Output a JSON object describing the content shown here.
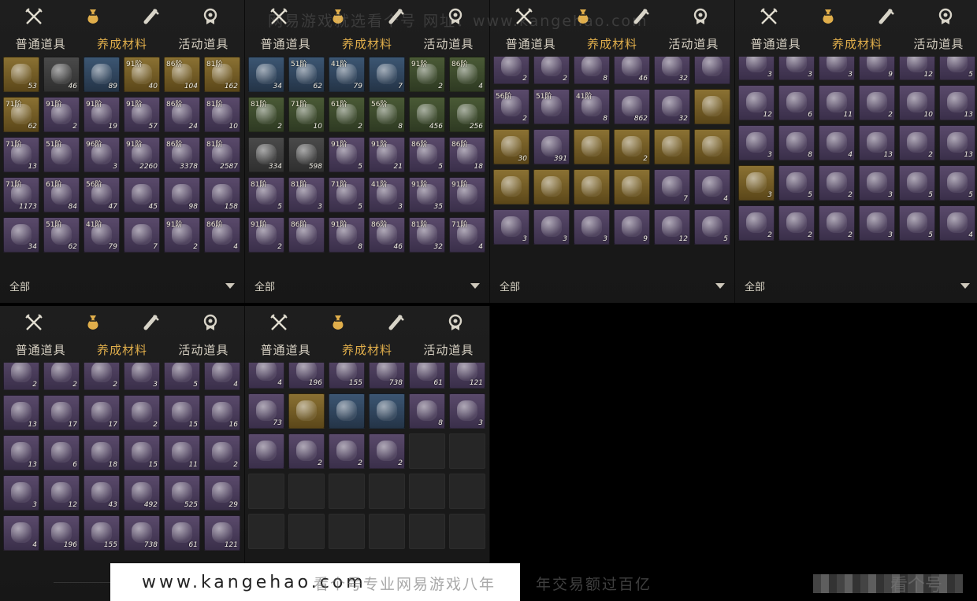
{
  "tabs": [
    "普通道具",
    "养成材料",
    "活动道具"
  ],
  "active_tab_index": 1,
  "filter_label": "全部",
  "watermark_top": "网易游戏就选看个号  网址：www.kangehao.com",
  "footer": {
    "url": "www.kangehao.com",
    "slogan": "看个号专业网易游戏八年",
    "slogan2": "年交易额过百亿",
    "logo": "看个号"
  },
  "colors": {
    "accent": "#e0ae4b",
    "panel_bg": "#1b1b1b"
  },
  "icons": [
    "swords-icon",
    "pouch-icon",
    "scroll-icon",
    "badge-icon"
  ],
  "panels": [
    {
      "id": "p1",
      "items": [
        {
          "r": "gold",
          "g": "",
          "c": "53"
        },
        {
          "r": "gray",
          "g": "",
          "c": "46"
        },
        {
          "r": "blue",
          "g": "",
          "c": "89"
        },
        {
          "r": "gold",
          "g": "91阶",
          "c": "40"
        },
        {
          "r": "gold",
          "g": "86阶",
          "c": "104"
        },
        {
          "r": "gold",
          "g": "81阶",
          "c": "162"
        },
        {
          "r": "gold",
          "g": "71阶",
          "c": "62"
        },
        {
          "r": "purple",
          "g": "91阶",
          "c": "2"
        },
        {
          "r": "purple",
          "g": "91阶",
          "c": "19"
        },
        {
          "r": "purple",
          "g": "91阶",
          "c": "57"
        },
        {
          "r": "purple",
          "g": "86阶",
          "c": "24"
        },
        {
          "r": "purple",
          "g": "81阶",
          "c": "10"
        },
        {
          "r": "purple",
          "g": "71阶",
          "c": "13"
        },
        {
          "r": "purple",
          "g": "51阶",
          "c": ""
        },
        {
          "r": "purple",
          "g": "96阶",
          "c": "3"
        },
        {
          "r": "purple",
          "g": "91阶",
          "c": "2260"
        },
        {
          "r": "purple",
          "g": "86阶",
          "c": "3378"
        },
        {
          "r": "purple",
          "g": "81阶",
          "c": "2587"
        },
        {
          "r": "purple",
          "g": "71阶",
          "c": "1173"
        },
        {
          "r": "purple",
          "g": "61阶",
          "c": "84"
        },
        {
          "r": "purple",
          "g": "56阶",
          "c": "47"
        },
        {
          "r": "purple",
          "g": "",
          "c": "45"
        },
        {
          "r": "purple",
          "g": "",
          "c": "98"
        },
        {
          "r": "purple",
          "g": "",
          "c": "158"
        },
        {
          "r": "purple",
          "g": "",
          "c": "34"
        },
        {
          "r": "purple",
          "g": "51阶",
          "c": "62"
        },
        {
          "r": "purple",
          "g": "41阶",
          "c": "79"
        },
        {
          "r": "purple",
          "g": "",
          "c": "7"
        },
        {
          "r": "purple",
          "g": "91阶",
          "c": "2"
        },
        {
          "r": "purple",
          "g": "86阶",
          "c": "4"
        }
      ]
    },
    {
      "id": "p2",
      "items": [
        {
          "r": "blue",
          "g": "",
          "c": "34"
        },
        {
          "r": "blue",
          "g": "51阶",
          "c": "62"
        },
        {
          "r": "blue",
          "g": "41阶",
          "c": "79"
        },
        {
          "r": "blue",
          "g": "",
          "c": "7"
        },
        {
          "r": "green",
          "g": "91阶",
          "c": "2"
        },
        {
          "r": "green",
          "g": "86阶",
          "c": "4"
        },
        {
          "r": "green",
          "g": "81阶",
          "c": "2"
        },
        {
          "r": "green",
          "g": "71阶",
          "c": "10"
        },
        {
          "r": "green",
          "g": "61阶",
          "c": "2"
        },
        {
          "r": "green",
          "g": "56阶",
          "c": "8"
        },
        {
          "r": "green",
          "g": "",
          "c": "456"
        },
        {
          "r": "green",
          "g": "",
          "c": "256"
        },
        {
          "r": "gray",
          "g": "",
          "c": "334"
        },
        {
          "r": "gray",
          "g": "",
          "c": "598"
        },
        {
          "r": "purple",
          "g": "91阶",
          "c": "5"
        },
        {
          "r": "purple",
          "g": "91阶",
          "c": "21"
        },
        {
          "r": "purple",
          "g": "86阶",
          "c": "5"
        },
        {
          "r": "purple",
          "g": "86阶",
          "c": "18"
        },
        {
          "r": "purple",
          "g": "81阶",
          "c": "5"
        },
        {
          "r": "purple",
          "g": "81阶",
          "c": "3"
        },
        {
          "r": "purple",
          "g": "71阶",
          "c": "5"
        },
        {
          "r": "purple",
          "g": "41阶",
          "c": "3"
        },
        {
          "r": "purple",
          "g": "91阶",
          "c": "35"
        },
        {
          "r": "purple",
          "g": "91阶",
          "c": ""
        },
        {
          "r": "purple",
          "g": "91阶",
          "c": "2"
        },
        {
          "r": "purple",
          "g": "86阶",
          "c": ""
        },
        {
          "r": "purple",
          "g": "91阶",
          "c": "8"
        },
        {
          "r": "purple",
          "g": "86阶",
          "c": "46"
        },
        {
          "r": "purple",
          "g": "81阶",
          "c": "32"
        },
        {
          "r": "purple",
          "g": "71阶",
          "c": "4"
        }
      ]
    },
    {
      "id": "p3",
      "items": [
        {
          "r": "purple",
          "g": "",
          "c": "2"
        },
        {
          "r": "purple",
          "g": "",
          "c": "2"
        },
        {
          "r": "purple",
          "g": "",
          "c": "8"
        },
        {
          "r": "purple",
          "g": "",
          "c": "46"
        },
        {
          "r": "purple",
          "g": "",
          "c": "32"
        },
        {
          "r": "purple",
          "g": "",
          "c": ""
        },
        {
          "r": "purple",
          "g": "56阶",
          "c": "2"
        },
        {
          "r": "purple",
          "g": "51阶",
          "c": ""
        },
        {
          "r": "purple",
          "g": "41阶",
          "c": "8"
        },
        {
          "r": "purple",
          "g": "",
          "c": "862"
        },
        {
          "r": "purple",
          "g": "",
          "c": "32"
        },
        {
          "r": "gold",
          "g": "",
          "c": ""
        },
        {
          "r": "gold",
          "g": "",
          "c": "30"
        },
        {
          "r": "purple",
          "g": "",
          "c": "391"
        },
        {
          "r": "gold",
          "g": "",
          "c": ""
        },
        {
          "r": "gold",
          "g": "",
          "c": "2"
        },
        {
          "r": "gold",
          "g": "",
          "c": ""
        },
        {
          "r": "gold",
          "g": "",
          "c": ""
        },
        {
          "r": "gold",
          "g": "",
          "c": ""
        },
        {
          "r": "gold",
          "g": "",
          "c": ""
        },
        {
          "r": "gold",
          "g": "",
          "c": ""
        },
        {
          "r": "gold",
          "g": "",
          "c": ""
        },
        {
          "r": "purple",
          "g": "",
          "c": "7"
        },
        {
          "r": "purple",
          "g": "",
          "c": "4"
        },
        {
          "r": "purple",
          "g": "",
          "c": "3"
        },
        {
          "r": "purple",
          "g": "",
          "c": "3"
        },
        {
          "r": "purple",
          "g": "",
          "c": "3"
        },
        {
          "r": "purple",
          "g": "",
          "c": "9"
        },
        {
          "r": "purple",
          "g": "",
          "c": "12"
        },
        {
          "r": "purple",
          "g": "",
          "c": "5"
        }
      ]
    },
    {
      "id": "p4",
      "items": [
        {
          "r": "purple",
          "g": "",
          "c": "3"
        },
        {
          "r": "purple",
          "g": "",
          "c": "3"
        },
        {
          "r": "purple",
          "g": "",
          "c": "3"
        },
        {
          "r": "purple",
          "g": "",
          "c": "9"
        },
        {
          "r": "purple",
          "g": "",
          "c": "12"
        },
        {
          "r": "purple",
          "g": "",
          "c": "5"
        },
        {
          "r": "purple",
          "g": "",
          "c": "12"
        },
        {
          "r": "purple",
          "g": "",
          "c": "6"
        },
        {
          "r": "purple",
          "g": "",
          "c": "11"
        },
        {
          "r": "purple",
          "g": "",
          "c": "2"
        },
        {
          "r": "purple",
          "g": "",
          "c": "10"
        },
        {
          "r": "purple",
          "g": "",
          "c": "13"
        },
        {
          "r": "purple",
          "g": "",
          "c": "3"
        },
        {
          "r": "purple",
          "g": "",
          "c": "8"
        },
        {
          "r": "purple",
          "g": "",
          "c": "4"
        },
        {
          "r": "purple",
          "g": "",
          "c": "13"
        },
        {
          "r": "purple",
          "g": "",
          "c": "2"
        },
        {
          "r": "purple",
          "g": "",
          "c": "13"
        },
        {
          "r": "gold",
          "g": "",
          "c": "3"
        },
        {
          "r": "purple",
          "g": "",
          "c": "5"
        },
        {
          "r": "purple",
          "g": "",
          "c": "2"
        },
        {
          "r": "purple",
          "g": "",
          "c": "3"
        },
        {
          "r": "purple",
          "g": "",
          "c": "5"
        },
        {
          "r": "purple",
          "g": "",
          "c": "5"
        },
        {
          "r": "purple",
          "g": "",
          "c": "2"
        },
        {
          "r": "purple",
          "g": "",
          "c": "2"
        },
        {
          "r": "purple",
          "g": "",
          "c": "2"
        },
        {
          "r": "purple",
          "g": "",
          "c": "3"
        },
        {
          "r": "purple",
          "g": "",
          "c": "5"
        },
        {
          "r": "purple",
          "g": "",
          "c": "4"
        }
      ]
    },
    {
      "id": "p5",
      "items": [
        {
          "r": "purple",
          "g": "",
          "c": "2"
        },
        {
          "r": "purple",
          "g": "",
          "c": "2"
        },
        {
          "r": "purple",
          "g": "",
          "c": "2"
        },
        {
          "r": "purple",
          "g": "",
          "c": "3"
        },
        {
          "r": "purple",
          "g": "",
          "c": "5"
        },
        {
          "r": "purple",
          "g": "",
          "c": "4"
        },
        {
          "r": "purple",
          "g": "",
          "c": "13"
        },
        {
          "r": "purple",
          "g": "",
          "c": "17"
        },
        {
          "r": "purple",
          "g": "",
          "c": "17"
        },
        {
          "r": "purple",
          "g": "",
          "c": "2"
        },
        {
          "r": "purple",
          "g": "",
          "c": "15"
        },
        {
          "r": "purple",
          "g": "",
          "c": "16"
        },
        {
          "r": "purple",
          "g": "",
          "c": "13"
        },
        {
          "r": "purple",
          "g": "",
          "c": "6"
        },
        {
          "r": "purple",
          "g": "",
          "c": "18"
        },
        {
          "r": "purple",
          "g": "",
          "c": "15"
        },
        {
          "r": "purple",
          "g": "",
          "c": "11"
        },
        {
          "r": "purple",
          "g": "",
          "c": "2"
        },
        {
          "r": "purple",
          "g": "",
          "c": "3"
        },
        {
          "r": "purple",
          "g": "",
          "c": "12"
        },
        {
          "r": "purple",
          "g": "",
          "c": "43"
        },
        {
          "r": "purple",
          "g": "",
          "c": "492"
        },
        {
          "r": "purple",
          "g": "",
          "c": "525"
        },
        {
          "r": "purple",
          "g": "",
          "c": "29"
        },
        {
          "r": "purple",
          "g": "",
          "c": "4"
        },
        {
          "r": "purple",
          "g": "",
          "c": "196"
        },
        {
          "r": "purple",
          "g": "",
          "c": "155"
        },
        {
          "r": "purple",
          "g": "",
          "c": "738"
        },
        {
          "r": "purple",
          "g": "",
          "c": "61"
        },
        {
          "r": "purple",
          "g": "",
          "c": "121"
        }
      ]
    },
    {
      "id": "p6",
      "items": [
        {
          "r": "purple",
          "g": "",
          "c": "4"
        },
        {
          "r": "purple",
          "g": "",
          "c": "196"
        },
        {
          "r": "purple",
          "g": "",
          "c": "155"
        },
        {
          "r": "purple",
          "g": "",
          "c": "738"
        },
        {
          "r": "purple",
          "g": "",
          "c": "61"
        },
        {
          "r": "purple",
          "g": "",
          "c": "121"
        },
        {
          "r": "purple",
          "g": "",
          "c": "73"
        },
        {
          "r": "gold",
          "g": "",
          "c": ""
        },
        {
          "r": "blue",
          "g": "",
          "c": ""
        },
        {
          "r": "blue",
          "g": "",
          "c": ""
        },
        {
          "r": "purple",
          "g": "",
          "c": "8"
        },
        {
          "r": "purple",
          "g": "",
          "c": "3"
        },
        {
          "r": "purple",
          "g": "",
          "c": ""
        },
        {
          "r": "purple",
          "g": "",
          "c": "2"
        },
        {
          "r": "purple",
          "g": "",
          "c": "2"
        },
        {
          "r": "purple",
          "g": "",
          "c": "2"
        },
        {
          "r": "empty",
          "g": "",
          "c": ""
        },
        {
          "r": "empty",
          "g": "",
          "c": ""
        },
        {
          "r": "empty",
          "g": "",
          "c": ""
        },
        {
          "r": "empty",
          "g": "",
          "c": ""
        },
        {
          "r": "empty",
          "g": "",
          "c": ""
        },
        {
          "r": "empty",
          "g": "",
          "c": ""
        },
        {
          "r": "empty",
          "g": "",
          "c": ""
        },
        {
          "r": "empty",
          "g": "",
          "c": ""
        },
        {
          "r": "empty",
          "g": "",
          "c": ""
        },
        {
          "r": "empty",
          "g": "",
          "c": ""
        },
        {
          "r": "empty",
          "g": "",
          "c": ""
        },
        {
          "r": "empty",
          "g": "",
          "c": ""
        },
        {
          "r": "empty",
          "g": "",
          "c": ""
        },
        {
          "r": "empty",
          "g": "",
          "c": ""
        }
      ]
    }
  ]
}
